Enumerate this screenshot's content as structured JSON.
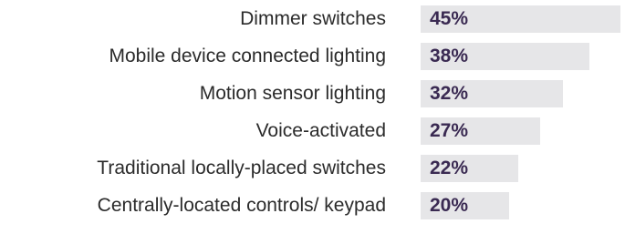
{
  "chart_data": {
    "type": "bar",
    "orientation": "horizontal",
    "categories": [
      "Dimmer switches",
      "Mobile device connected lighting",
      "Motion sensor lighting",
      "Voice-activated",
      "Traditional locally-placed switches",
      "Centrally-located controls/ keypad"
    ],
    "values": [
      45,
      38,
      32,
      27,
      22,
      20
    ],
    "value_labels": [
      "45%",
      "38%",
      "32%",
      "27%",
      "22%",
      "20%"
    ],
    "unit": "%",
    "xlim": [
      0,
      100
    ],
    "grid": false,
    "legend": "none",
    "colors": {
      "bar": "#e6e6e8",
      "category_text": "#2b2b2b",
      "value_text": "#3a2a52"
    }
  }
}
